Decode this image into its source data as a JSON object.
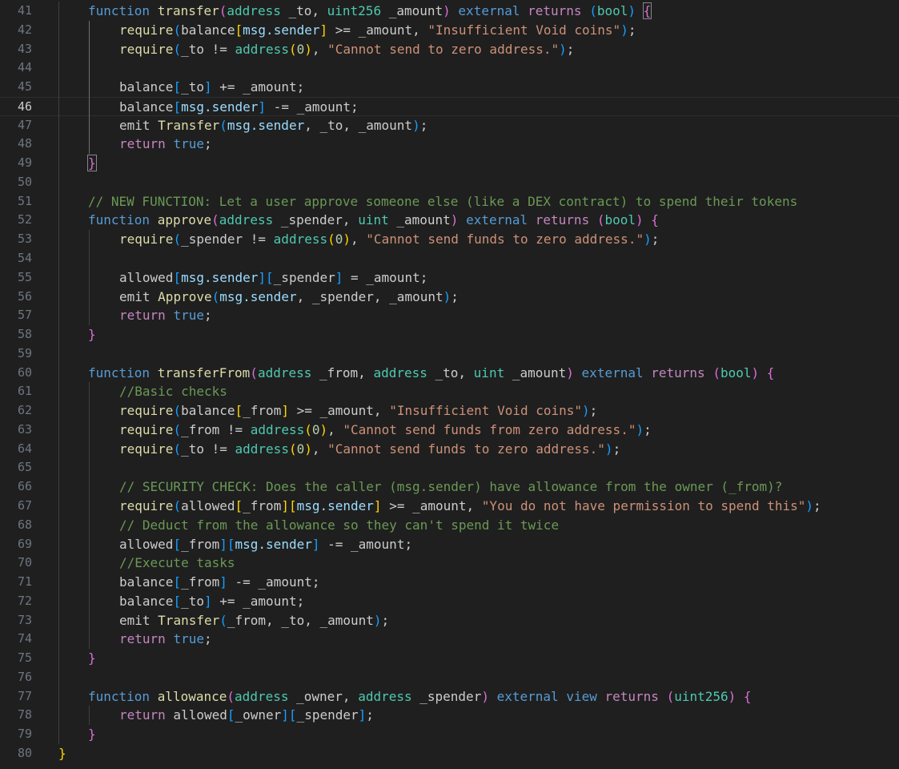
{
  "editor": {
    "language": "solidity",
    "colors": {
      "background": "#1f1f1f",
      "keyword": "#569cd6",
      "control": "#c586c0",
      "function": "#dcdcaa",
      "type": "#4ec9b0",
      "variable": "#9cdcfe",
      "string": "#ce9178",
      "number": "#b5cea8",
      "comment": "#6a9955",
      "bracket1": "#ffd700",
      "bracket2": "#da70d6",
      "bracket3": "#179fff"
    },
    "current_line": 46,
    "lines": [
      {
        "n": 41,
        "indent": 1,
        "tokens": [
          [
            "kw",
            "function"
          ],
          [
            "plain",
            " "
          ],
          [
            "fn",
            "transfer"
          ],
          [
            "p2",
            "("
          ],
          [
            "ty",
            "address"
          ],
          [
            "plain",
            " _to, "
          ],
          [
            "ty",
            "uint256"
          ],
          [
            "plain",
            " _amount"
          ],
          [
            "p2",
            ")"
          ],
          [
            "plain",
            " "
          ],
          [
            "kw",
            "external"
          ],
          [
            "plain",
            " "
          ],
          [
            "ctl",
            "returns"
          ],
          [
            "plain",
            " "
          ],
          [
            "p3",
            "("
          ],
          [
            "ty",
            "bool"
          ],
          [
            "p3",
            ")"
          ],
          [
            "plain",
            " "
          ],
          [
            "p2b",
            "{"
          ]
        ]
      },
      {
        "n": 42,
        "indent": 2,
        "tokens": [
          [
            "fn",
            "require"
          ],
          [
            "p3",
            "("
          ],
          [
            "plain",
            "balance"
          ],
          [
            "p1",
            "["
          ],
          [
            "var",
            "msg.sender"
          ],
          [
            "p1",
            "]"
          ],
          [
            "plain",
            " >= _amount, "
          ],
          [
            "str",
            "\"Insufficient Void coins\""
          ],
          [
            "p3",
            ")"
          ],
          [
            "plain",
            ";"
          ]
        ]
      },
      {
        "n": 43,
        "indent": 2,
        "tokens": [
          [
            "fn",
            "require"
          ],
          [
            "p3",
            "("
          ],
          [
            "plain",
            "_to != "
          ],
          [
            "ty",
            "address"
          ],
          [
            "p1",
            "("
          ],
          [
            "num",
            "0"
          ],
          [
            "p1",
            ")"
          ],
          [
            "plain",
            ", "
          ],
          [
            "str",
            "\"Cannot send to zero address.\""
          ],
          [
            "p3",
            ")"
          ],
          [
            "plain",
            ";"
          ]
        ]
      },
      {
        "n": 44,
        "indent": 0,
        "tokens": []
      },
      {
        "n": 45,
        "indent": 2,
        "tokens": [
          [
            "plain",
            "balance"
          ],
          [
            "p3",
            "["
          ],
          [
            "plain",
            "_to"
          ],
          [
            "p3",
            "]"
          ],
          [
            "plain",
            " += _amount;"
          ]
        ]
      },
      {
        "n": 46,
        "indent": 2,
        "tokens": [
          [
            "plain",
            "balance"
          ],
          [
            "p3",
            "["
          ],
          [
            "var",
            "msg.sender"
          ],
          [
            "p3",
            "]"
          ],
          [
            "plain",
            " -= _amount;"
          ]
        ]
      },
      {
        "n": 47,
        "indent": 2,
        "tokens": [
          [
            "plain",
            "emit "
          ],
          [
            "fn",
            "Transfer"
          ],
          [
            "p3",
            "("
          ],
          [
            "var",
            "msg.sender"
          ],
          [
            "plain",
            ", _to, _amount"
          ],
          [
            "p3",
            ")"
          ],
          [
            "plain",
            ";"
          ]
        ]
      },
      {
        "n": 48,
        "indent": 2,
        "tokens": [
          [
            "ctl",
            "return"
          ],
          [
            "plain",
            " "
          ],
          [
            "kw",
            "true"
          ],
          [
            "plain",
            ";"
          ]
        ]
      },
      {
        "n": 49,
        "indent": 1,
        "tokens": [
          [
            "p2b",
            "}"
          ]
        ]
      },
      {
        "n": 50,
        "indent": 0,
        "tokens": []
      },
      {
        "n": 51,
        "indent": 1,
        "tokens": [
          [
            "com",
            "// NEW FUNCTION: Let a user approve someone else (like a DEX contract) to spend their tokens"
          ]
        ]
      },
      {
        "n": 52,
        "indent": 1,
        "tokens": [
          [
            "kw",
            "function"
          ],
          [
            "plain",
            " "
          ],
          [
            "fn",
            "approve"
          ],
          [
            "p2",
            "("
          ],
          [
            "ty",
            "address"
          ],
          [
            "plain",
            " _spender, "
          ],
          [
            "ty",
            "uint"
          ],
          [
            "plain",
            " _amount"
          ],
          [
            "p2",
            ")"
          ],
          [
            "plain",
            " "
          ],
          [
            "kw",
            "external"
          ],
          [
            "plain",
            " "
          ],
          [
            "ctl",
            "returns"
          ],
          [
            "plain",
            " "
          ],
          [
            "p2",
            "("
          ],
          [
            "ty",
            "bool"
          ],
          [
            "p2",
            ")"
          ],
          [
            "plain",
            " "
          ],
          [
            "p2",
            "{"
          ]
        ]
      },
      {
        "n": 53,
        "indent": 2,
        "tokens": [
          [
            "fn",
            "require"
          ],
          [
            "p3",
            "("
          ],
          [
            "plain",
            "_spender != "
          ],
          [
            "ty",
            "address"
          ],
          [
            "p1",
            "("
          ],
          [
            "num",
            "0"
          ],
          [
            "p1",
            ")"
          ],
          [
            "plain",
            ", "
          ],
          [
            "str",
            "\"Cannot send funds to zero address.\""
          ],
          [
            "p3",
            ")"
          ],
          [
            "plain",
            ";"
          ]
        ]
      },
      {
        "n": 54,
        "indent": 0,
        "tokens": []
      },
      {
        "n": 55,
        "indent": 2,
        "tokens": [
          [
            "plain",
            "allowed"
          ],
          [
            "p3",
            "["
          ],
          [
            "var",
            "msg.sender"
          ],
          [
            "p3",
            "]["
          ],
          [
            "plain",
            "_spender"
          ],
          [
            "p3",
            "]"
          ],
          [
            "plain",
            " = _amount;"
          ]
        ]
      },
      {
        "n": 56,
        "indent": 2,
        "tokens": [
          [
            "plain",
            "emit "
          ],
          [
            "fn",
            "Approve"
          ],
          [
            "p3",
            "("
          ],
          [
            "var",
            "msg.sender"
          ],
          [
            "plain",
            ", _spender, _amount"
          ],
          [
            "p3",
            ")"
          ],
          [
            "plain",
            ";"
          ]
        ]
      },
      {
        "n": 57,
        "indent": 2,
        "tokens": [
          [
            "ctl",
            "return"
          ],
          [
            "plain",
            " "
          ],
          [
            "kw",
            "true"
          ],
          [
            "plain",
            ";"
          ]
        ]
      },
      {
        "n": 58,
        "indent": 1,
        "tokens": [
          [
            "p2",
            "}"
          ]
        ]
      },
      {
        "n": 59,
        "indent": 0,
        "tokens": []
      },
      {
        "n": 60,
        "indent": 1,
        "tokens": [
          [
            "kw",
            "function"
          ],
          [
            "plain",
            " "
          ],
          [
            "fn",
            "transferFrom"
          ],
          [
            "p2",
            "("
          ],
          [
            "ty",
            "address"
          ],
          [
            "plain",
            " _from, "
          ],
          [
            "ty",
            "address"
          ],
          [
            "plain",
            " _to, "
          ],
          [
            "ty",
            "uint"
          ],
          [
            "plain",
            " _amount"
          ],
          [
            "p2",
            ")"
          ],
          [
            "plain",
            " "
          ],
          [
            "kw",
            "external"
          ],
          [
            "plain",
            " "
          ],
          [
            "ctl",
            "returns"
          ],
          [
            "plain",
            " "
          ],
          [
            "p2",
            "("
          ],
          [
            "ty",
            "bool"
          ],
          [
            "p2",
            ")"
          ],
          [
            "plain",
            " "
          ],
          [
            "p2",
            "{"
          ]
        ]
      },
      {
        "n": 61,
        "indent": 2,
        "tokens": [
          [
            "com",
            "//Basic checks"
          ]
        ]
      },
      {
        "n": 62,
        "indent": 2,
        "tokens": [
          [
            "fn",
            "require"
          ],
          [
            "p3",
            "("
          ],
          [
            "plain",
            "balance"
          ],
          [
            "p1",
            "["
          ],
          [
            "plain",
            "_from"
          ],
          [
            "p1",
            "]"
          ],
          [
            "plain",
            " >= _amount, "
          ],
          [
            "str",
            "\"Insufficient Void coins\""
          ],
          [
            "p3",
            ")"
          ],
          [
            "plain",
            ";"
          ]
        ]
      },
      {
        "n": 63,
        "indent": 2,
        "tokens": [
          [
            "fn",
            "require"
          ],
          [
            "p3",
            "("
          ],
          [
            "plain",
            "_from != "
          ],
          [
            "ty",
            "address"
          ],
          [
            "p1",
            "("
          ],
          [
            "num",
            "0"
          ],
          [
            "p1",
            ")"
          ],
          [
            "plain",
            ", "
          ],
          [
            "str",
            "\"Cannot send funds from zero address.\""
          ],
          [
            "p3",
            ")"
          ],
          [
            "plain",
            ";"
          ]
        ]
      },
      {
        "n": 64,
        "indent": 2,
        "tokens": [
          [
            "fn",
            "require"
          ],
          [
            "p3",
            "("
          ],
          [
            "plain",
            "_to != "
          ],
          [
            "ty",
            "address"
          ],
          [
            "p1",
            "("
          ],
          [
            "num",
            "0"
          ],
          [
            "p1",
            ")"
          ],
          [
            "plain",
            ", "
          ],
          [
            "str",
            "\"Cannot send funds to zero address.\""
          ],
          [
            "p3",
            ")"
          ],
          [
            "plain",
            ";"
          ]
        ]
      },
      {
        "n": 65,
        "indent": 0,
        "tokens": []
      },
      {
        "n": 66,
        "indent": 2,
        "tokens": [
          [
            "com",
            "// SECURITY CHECK: Does the caller (msg.sender) have allowance from the owner (_from)?"
          ]
        ]
      },
      {
        "n": 67,
        "indent": 2,
        "tokens": [
          [
            "fn",
            "require"
          ],
          [
            "p3",
            "("
          ],
          [
            "plain",
            "allowed"
          ],
          [
            "p1",
            "["
          ],
          [
            "plain",
            "_from"
          ],
          [
            "p1",
            "]["
          ],
          [
            "var",
            "msg.sender"
          ],
          [
            "p1",
            "]"
          ],
          [
            "plain",
            " >= _amount, "
          ],
          [
            "str",
            "\"You do not have permission to spend this\""
          ],
          [
            "p3",
            ")"
          ],
          [
            "plain",
            ";"
          ]
        ]
      },
      {
        "n": 68,
        "indent": 2,
        "tokens": [
          [
            "com",
            "// Deduct from the allowance so they can't spend it twice"
          ]
        ]
      },
      {
        "n": 69,
        "indent": 2,
        "tokens": [
          [
            "plain",
            "allowed"
          ],
          [
            "p3",
            "["
          ],
          [
            "plain",
            "_from"
          ],
          [
            "p3",
            "]["
          ],
          [
            "var",
            "msg.sender"
          ],
          [
            "p3",
            "]"
          ],
          [
            "plain",
            " -= _amount;"
          ]
        ]
      },
      {
        "n": 70,
        "indent": 2,
        "tokens": [
          [
            "com",
            "//Execute tasks"
          ]
        ]
      },
      {
        "n": 71,
        "indent": 2,
        "tokens": [
          [
            "plain",
            "balance"
          ],
          [
            "p3",
            "["
          ],
          [
            "plain",
            "_from"
          ],
          [
            "p3",
            "]"
          ],
          [
            "plain",
            " -= _amount;"
          ]
        ]
      },
      {
        "n": 72,
        "indent": 2,
        "tokens": [
          [
            "plain",
            "balance"
          ],
          [
            "p3",
            "["
          ],
          [
            "plain",
            "_to"
          ],
          [
            "p3",
            "]"
          ],
          [
            "plain",
            " += _amount;"
          ]
        ]
      },
      {
        "n": 73,
        "indent": 2,
        "tokens": [
          [
            "plain",
            "emit "
          ],
          [
            "fn",
            "Transfer"
          ],
          [
            "p3",
            "("
          ],
          [
            "plain",
            "_from, _to, _amount"
          ],
          [
            "p3",
            ")"
          ],
          [
            "plain",
            ";"
          ]
        ]
      },
      {
        "n": 74,
        "indent": 2,
        "tokens": [
          [
            "ctl",
            "return"
          ],
          [
            "plain",
            " "
          ],
          [
            "kw",
            "true"
          ],
          [
            "plain",
            ";"
          ]
        ]
      },
      {
        "n": 75,
        "indent": 1,
        "tokens": [
          [
            "p2",
            "}"
          ]
        ]
      },
      {
        "n": 76,
        "indent": 0,
        "tokens": []
      },
      {
        "n": 77,
        "indent": 1,
        "tokens": [
          [
            "kw",
            "function"
          ],
          [
            "plain",
            " "
          ],
          [
            "fn",
            "allowance"
          ],
          [
            "p2",
            "("
          ],
          [
            "ty",
            "address"
          ],
          [
            "plain",
            " _owner, "
          ],
          [
            "ty",
            "address"
          ],
          [
            "plain",
            " _spender"
          ],
          [
            "p2",
            ")"
          ],
          [
            "plain",
            " "
          ],
          [
            "kw",
            "external"
          ],
          [
            "plain",
            " "
          ],
          [
            "kw",
            "view"
          ],
          [
            "plain",
            " "
          ],
          [
            "ctl",
            "returns"
          ],
          [
            "plain",
            " "
          ],
          [
            "p2",
            "("
          ],
          [
            "ty",
            "uint256"
          ],
          [
            "p2",
            ")"
          ],
          [
            "plain",
            " "
          ],
          [
            "p2",
            "{"
          ]
        ]
      },
      {
        "n": 78,
        "indent": 2,
        "tokens": [
          [
            "ctl",
            "return"
          ],
          [
            "plain",
            " allowed"
          ],
          [
            "p3",
            "["
          ],
          [
            "plain",
            "_owner"
          ],
          [
            "p3",
            "]["
          ],
          [
            "plain",
            "_spender"
          ],
          [
            "p3",
            "]"
          ],
          [
            "plain",
            ";"
          ]
        ]
      },
      {
        "n": 79,
        "indent": 1,
        "tokens": [
          [
            "p2",
            "}"
          ]
        ]
      },
      {
        "n": 80,
        "indent": 0,
        "tokens": [
          [
            "p1",
            "}"
          ]
        ]
      }
    ]
  }
}
